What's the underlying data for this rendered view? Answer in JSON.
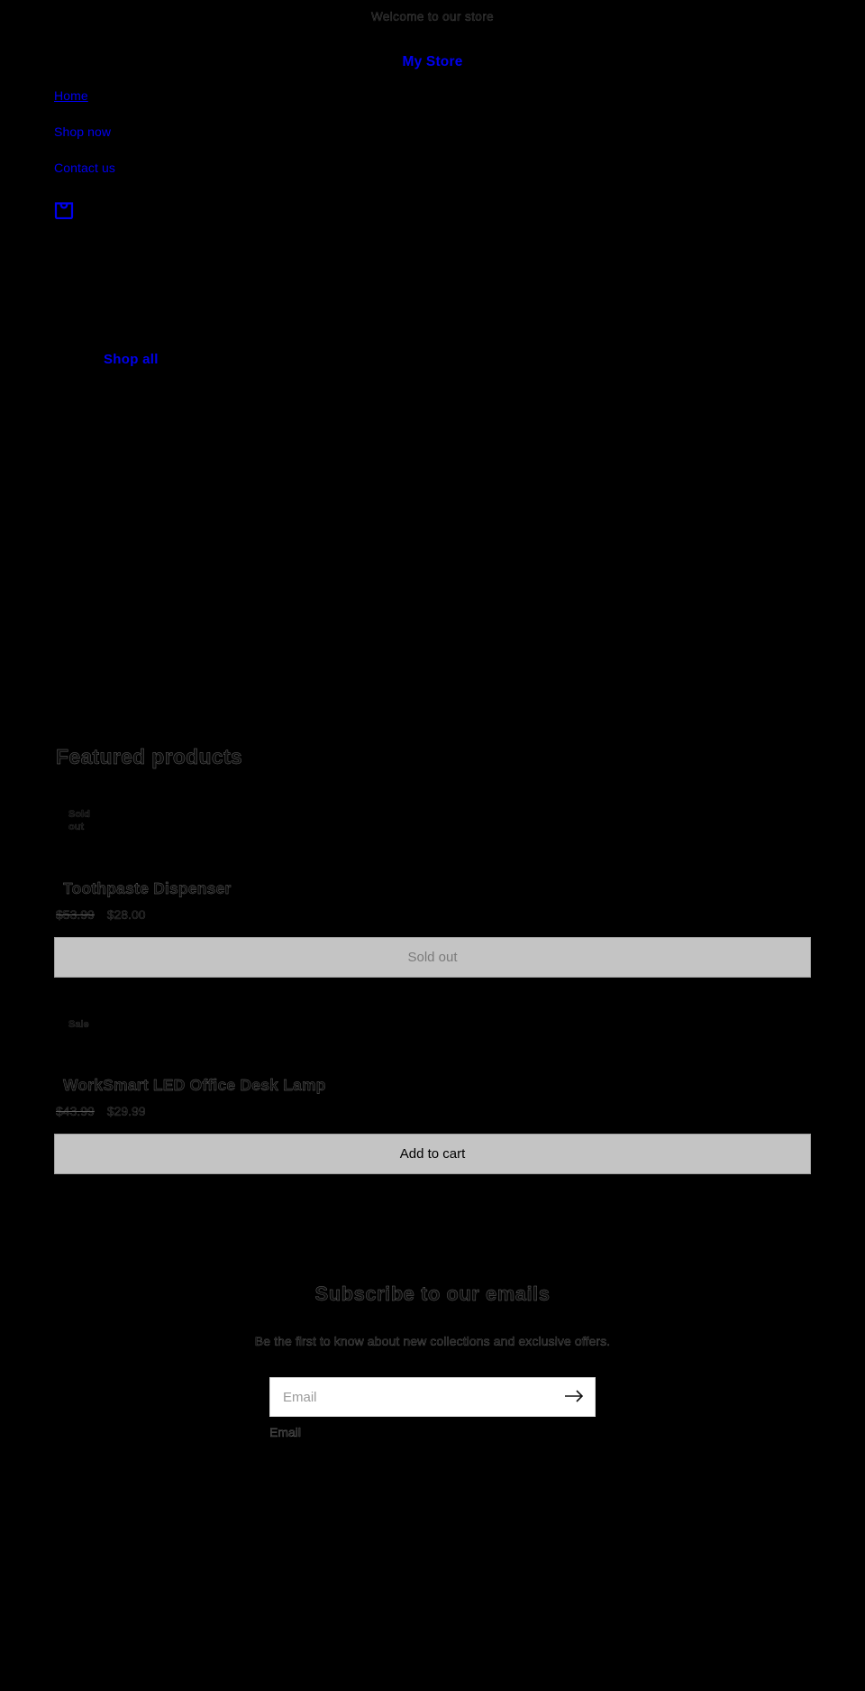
{
  "announcement": {
    "text": "Welcome to our store"
  },
  "header": {
    "brand": "My Store",
    "nav": [
      {
        "label": "Home",
        "name": "nav-link-home"
      },
      {
        "label": "Shop now",
        "name": "nav-link-shop-now"
      },
      {
        "label": "Contact us",
        "name": "nav-link-contact-us"
      }
    ],
    "cart_icon": "shopping-bag-icon"
  },
  "hero": {
    "cta_label": "Shop all"
  },
  "featured": {
    "heading": "Featured products",
    "products": [
      {
        "badge": "Sold out",
        "title": "Toothpaste Dispenser",
        "compare_at_price": "$53.99",
        "price": "$28.00",
        "button_label": "Sold out",
        "available": false
      },
      {
        "badge": "Sale",
        "title": "WorkSmart LED Office Desk Lamp",
        "compare_at_price": "$43.99",
        "price": "$29.99",
        "button_label": "Add to cart",
        "available": true
      }
    ]
  },
  "newsletter": {
    "title": "Subscribe to our emails",
    "subtitle": "Be the first to know about new collections and exclusive offers.",
    "input_placeholder": "Email",
    "input_value": "",
    "field_label": "Email",
    "submit_icon": "arrow-right-icon"
  },
  "colors": {
    "background": "#000000",
    "link": "#0000EE",
    "button_bg": "#C4C4C4",
    "input_bg": "#FFFFFF"
  }
}
